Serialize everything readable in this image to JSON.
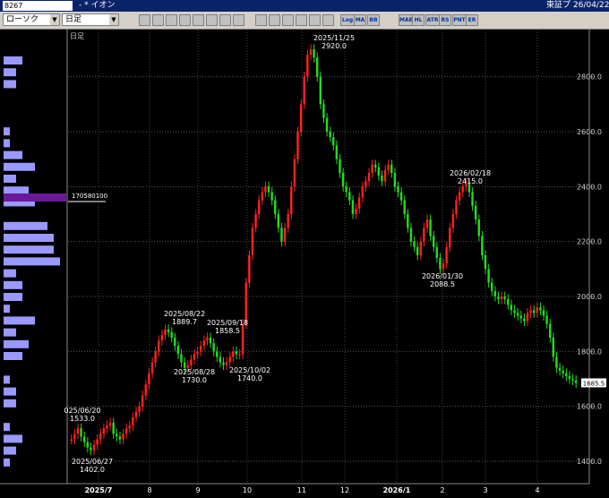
{
  "window": {
    "code": "8267",
    "title": "- * イオン",
    "exchange": "東証プ",
    "date": "26/04/22"
  },
  "toolbar": {
    "chart_type": "ローソク",
    "period": "日足",
    "buttons": [
      "zoom",
      "search",
      "up-down",
      "up-down2",
      "line",
      "red",
      "HL",
      "check",
      "mail",
      "note",
      "copy",
      "print",
      "palette",
      "camera",
      "Log",
      "MA",
      "BB",
      "MAE",
      "HL",
      "ATR",
      "RS",
      "PNT",
      "ER"
    ]
  },
  "chart_data": {
    "type": "candlestick",
    "period_label": "日足",
    "price_ticks": [
      1400,
      1600,
      1800,
      2000,
      2200,
      2400,
      2600,
      2800
    ],
    "x_labels": [
      "2025/7",
      "8",
      "9",
      "10",
      "11",
      "12",
      "2026/1",
      "2",
      "3",
      "4"
    ],
    "last_price": "1685.5",
    "volume_profile_marker": "170580100",
    "annotations": [
      {
        "date": "2025/11/25",
        "value": "2920.0"
      },
      {
        "date": "2026/02/18",
        "value": "2415.0"
      },
      {
        "date": "2026/01/30",
        "value": "2088.5"
      },
      {
        "date": "2025/08/22",
        "value": "1889.7"
      },
      {
        "date": "2025/09/18",
        "value": "1858.5"
      },
      {
        "date": "2025/08/28",
        "value": "1730.0"
      },
      {
        "date": "2025/10/02",
        "value": "1740.0"
      },
      {
        "date": "025/06/20",
        "value": "1533.0"
      },
      {
        "date": "2025/06/27",
        "value": "1402.0"
      }
    ],
    "volume_profile": [
      3,
      2,
      2,
      0,
      0,
      0,
      1,
      1,
      3,
      5,
      2,
      4,
      5,
      0,
      7,
      8,
      8,
      9,
      2,
      3,
      3,
      1,
      5,
      2,
      4,
      3,
      0,
      1,
      2,
      2,
      0,
      1,
      3,
      2,
      1,
      0
    ],
    "close_path": [
      1480,
      1500,
      1520,
      1490,
      1470,
      1450,
      1440,
      1460,
      1480,
      1500,
      1520,
      1530,
      1540,
      1500,
      1490,
      1480,
      1500,
      1520,
      1530,
      1560,
      1580,
      1600,
      1640,
      1680,
      1720,
      1760,
      1800,
      1840,
      1860,
      1880,
      1870,
      1850,
      1820,
      1790,
      1760,
      1740,
      1750,
      1770,
      1790,
      1800,
      1820,
      1840,
      1850,
      1830,
      1800,
      1780,
      1760,
      1750,
      1760,
      1780,
      1800,
      1790,
      1790,
      1900,
      2050,
      2150,
      2250,
      2300,
      2350,
      2380,
      2400,
      2380,
      2350,
      2300,
      2250,
      2200,
      2250,
      2300,
      2400,
      2500,
      2600,
      2700,
      2800,
      2880,
      2900,
      2870,
      2800,
      2700,
      2650,
      2600,
      2580,
      2550,
      2500,
      2450,
      2400,
      2380,
      2350,
      2300,
      2320,
      2360,
      2400,
      2420,
      2450,
      2480,
      2470,
      2440,
      2420,
      2460,
      2480,
      2450,
      2400,
      2380,
      2350,
      2300,
      2250,
      2200,
      2180,
      2150,
      2200,
      2250,
      2280,
      2220,
      2180,
      2140,
      2100,
      2120,
      2180,
      2250,
      2300,
      2350,
      2380,
      2400,
      2410,
      2380,
      2330,
      2280,
      2220,
      2150,
      2100,
      2050,
      2020,
      2000,
      1990,
      2000,
      1990,
      1970,
      1950,
      1940,
      1930,
      1920,
      1910,
      1940,
      1950,
      1940,
      1960,
      1950,
      1930,
      1900,
      1850,
      1780,
      1740,
      1730,
      1720,
      1710,
      1700,
      1695,
      1685
    ]
  }
}
